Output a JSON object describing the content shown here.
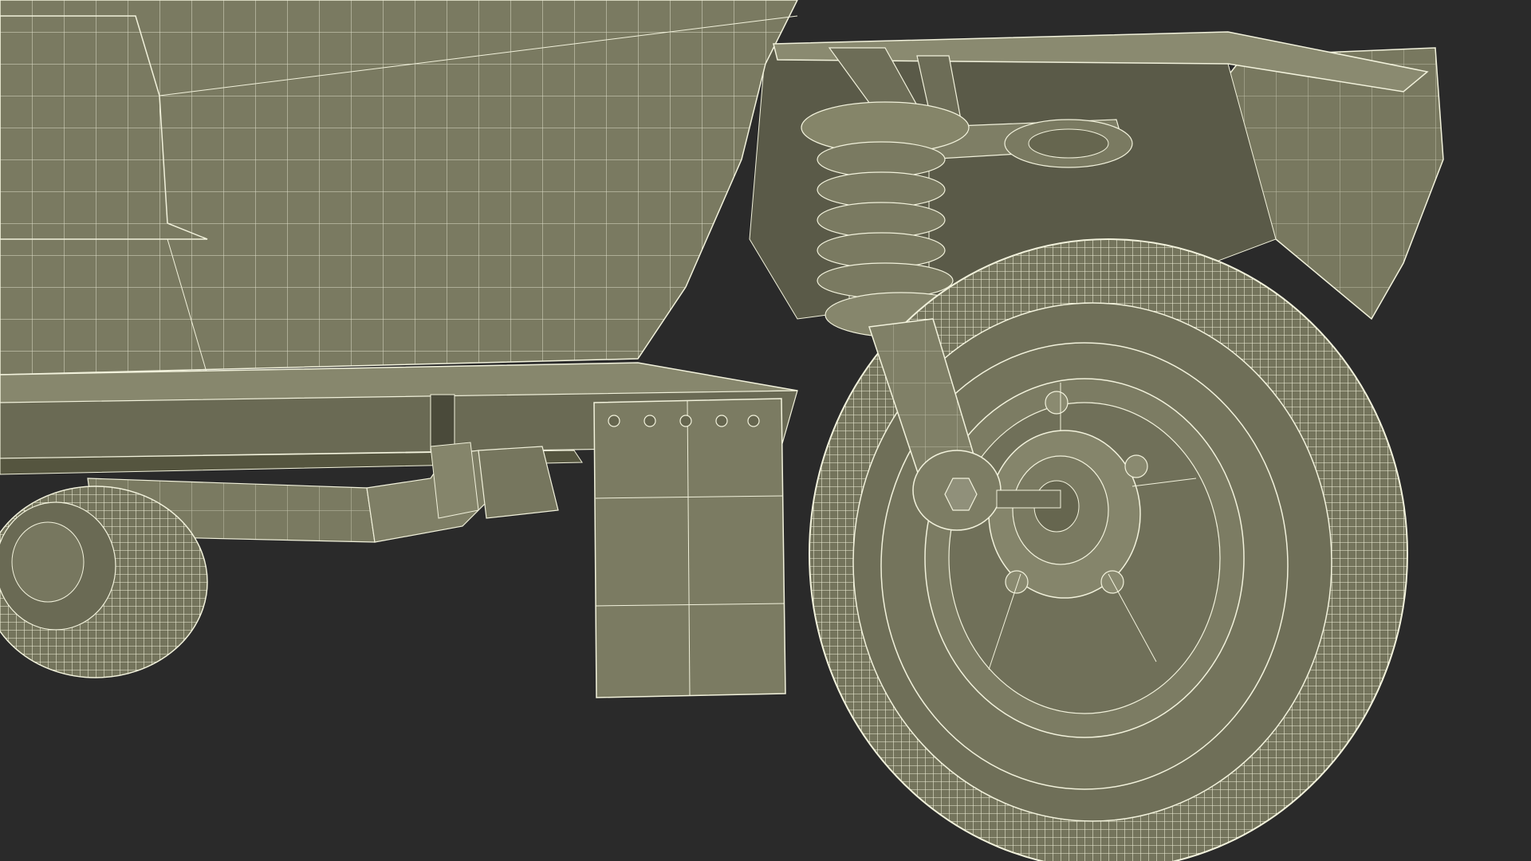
{
  "scene": {
    "colors": {
      "background": "#2a2a2a",
      "surface": "#78785f",
      "surface_light": "#84846b",
      "surface_dark": "#5f5f4c",
      "shadow": "#4d4d3e",
      "wire": "#f2f2dc"
    }
  }
}
